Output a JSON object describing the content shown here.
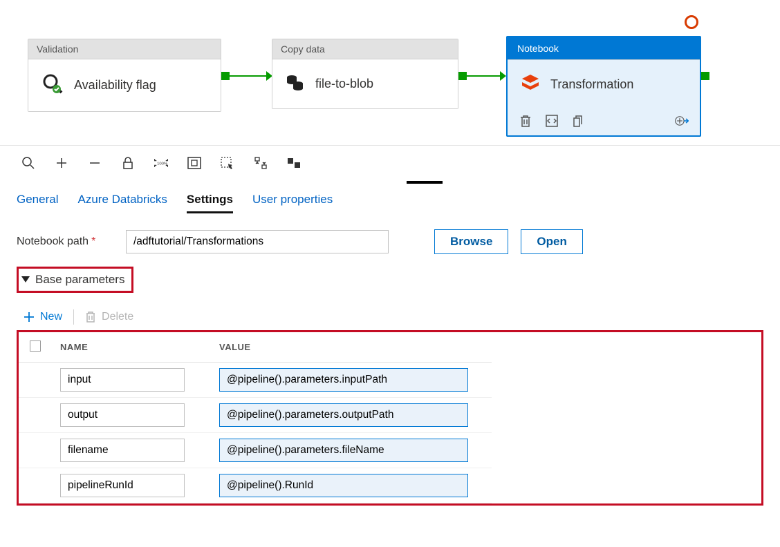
{
  "nodes": {
    "validation": {
      "type": "Validation",
      "title": "Availability flag"
    },
    "copy": {
      "type": "Copy data",
      "title": "file-to-blob"
    },
    "notebook": {
      "type": "Notebook",
      "title": "Transformation"
    }
  },
  "tabs": {
    "general": "General",
    "databricks": "Azure Databricks",
    "settings": "Settings",
    "userprops": "User properties"
  },
  "settings": {
    "notebook_path_label": "Notebook path",
    "notebook_path_value": "/adftutorial/Transformations",
    "browse": "Browse",
    "open": "Open",
    "base_params_label": "Base parameters",
    "new": "New",
    "delete": "Delete",
    "col_name": "NAME",
    "col_value": "VALUE",
    "params": [
      {
        "name": "input",
        "value": "@pipeline().parameters.inputPath"
      },
      {
        "name": "output",
        "value": "@pipeline().parameters.outputPath"
      },
      {
        "name": "filename",
        "value": "@pipeline().parameters.fileName"
      },
      {
        "name": "pipelineRunId",
        "value": "@pipeline().RunId"
      }
    ]
  }
}
